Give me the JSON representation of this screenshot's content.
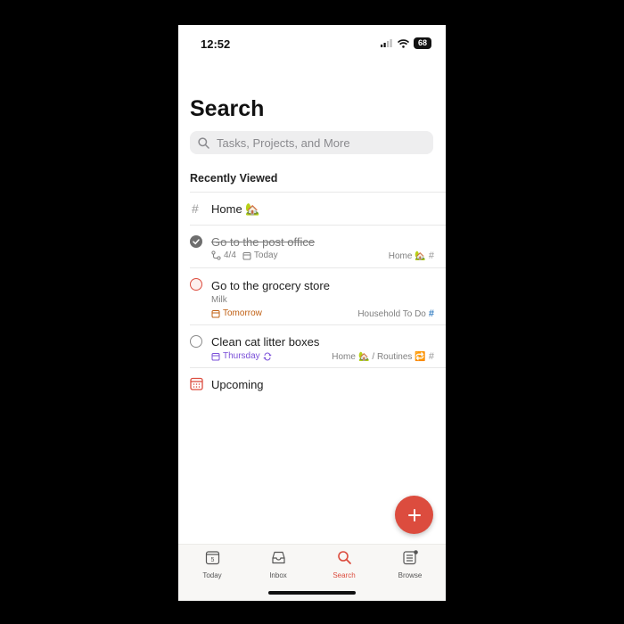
{
  "status_bar": {
    "time": "12:52",
    "battery": "68"
  },
  "header": {
    "title": "Search"
  },
  "search": {
    "placeholder": "Tasks, Projects, and More"
  },
  "section": {
    "title": "Recently Viewed"
  },
  "items": [
    {
      "type": "project",
      "title": "Home",
      "emoji": "🏡"
    },
    {
      "type": "task",
      "title": "Go to the post office",
      "completed": true,
      "subtasks": "4/4",
      "date": "Today",
      "project": "Home",
      "project_emoji": "🏡",
      "project_suffix": "#"
    },
    {
      "type": "task",
      "title": "Go to the grocery store",
      "priority_color": "#dc4c3e",
      "description": "Milk",
      "date": "Tomorrow",
      "project": "Household To Do",
      "project_suffix": "#"
    },
    {
      "type": "task",
      "title": "Clean cat litter boxes",
      "date": "Thursday",
      "recurring": true,
      "project": "Home",
      "project_emoji": "🏡",
      "section": "/ Routines",
      "section_icon": "🔁",
      "project_suffix": "#"
    },
    {
      "type": "filter",
      "title": "Upcoming"
    }
  ],
  "tabs": [
    {
      "label": "Today",
      "day_number": "5",
      "active": false
    },
    {
      "label": "Inbox",
      "active": false
    },
    {
      "label": "Search",
      "active": true
    },
    {
      "label": "Browse",
      "active": false
    }
  ],
  "colors": {
    "accent": "#dc4c3e",
    "orange_date": "#c05f12",
    "purple_date": "#7a4fd8",
    "blue_hash": "#3b82c4"
  },
  "fab": {
    "icon": "plus-icon"
  }
}
